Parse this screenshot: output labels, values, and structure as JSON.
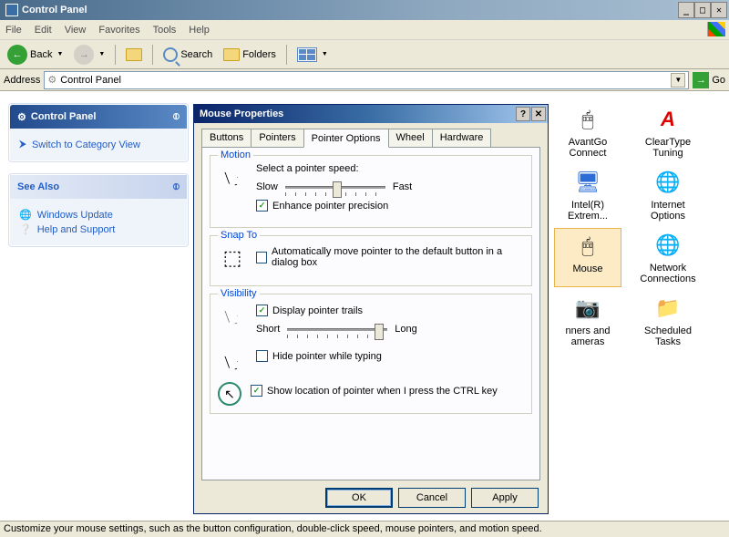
{
  "window": {
    "title": "Control Panel"
  },
  "menu": {
    "items": [
      "File",
      "Edit",
      "View",
      "Favorites",
      "Tools",
      "Help"
    ]
  },
  "toolbar": {
    "back": "Back",
    "search": "Search",
    "folders": "Folders"
  },
  "address": {
    "label": "Address",
    "value": "Control Panel",
    "go": "Go"
  },
  "sidebar": {
    "primary": {
      "title": "Control Panel",
      "item": "Switch to Category View"
    },
    "secondary": {
      "title": "See Also",
      "items": [
        "Windows Update",
        "Help and Support"
      ]
    }
  },
  "icons": {
    "i0": {
      "label": "AvantGo Connect"
    },
    "i1": {
      "label": "ClearType Tuning"
    },
    "i2": {
      "label": "Intel(R) Extrem..."
    },
    "i3": {
      "label": "Internet Options"
    },
    "i4": {
      "label": "Mouse"
    },
    "i5": {
      "label": "Network Connections"
    },
    "i6": {
      "label": "nners and ameras"
    },
    "i7": {
      "label": "Scheduled Tasks"
    }
  },
  "dialog": {
    "title": "Mouse Properties",
    "tabs": [
      "Buttons",
      "Pointers",
      "Pointer Options",
      "Wheel",
      "Hardware"
    ],
    "active_tab": 2,
    "motion": {
      "legend": "Motion",
      "label": "Select a pointer speed:",
      "slow": "Slow",
      "fast": "Fast",
      "enhance": "Enhance pointer precision",
      "enhance_checked": true
    },
    "snapto": {
      "legend": "Snap To",
      "label": "Automatically move pointer to the default button in a dialog box",
      "checked": false
    },
    "visibility": {
      "legend": "Visibility",
      "trails": "Display pointer trails",
      "trails_checked": true,
      "short": "Short",
      "long": "Long",
      "hide": "Hide pointer while typing",
      "hide_checked": false,
      "ctrl": "Show location of pointer when I press the CTRL key",
      "ctrl_checked": true
    },
    "buttons": {
      "ok": "OK",
      "cancel": "Cancel",
      "apply": "Apply"
    }
  },
  "status": "Customize your mouse settings, such as the button configuration, double-click speed, mouse pointers, and motion speed."
}
